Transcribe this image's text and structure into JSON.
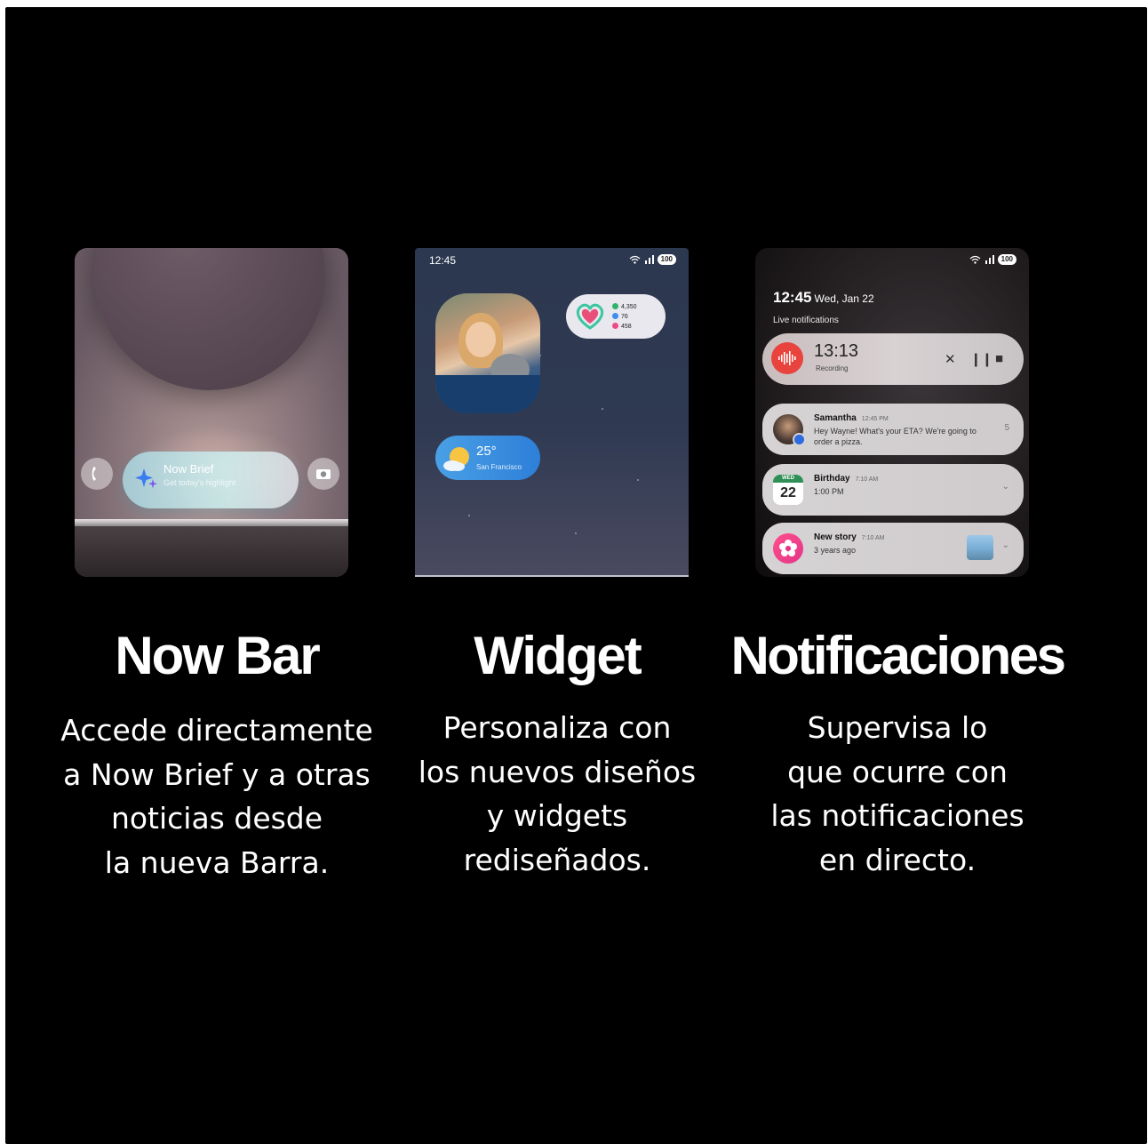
{
  "columns": [
    {
      "id": "now-bar",
      "title": "Now Bar",
      "lines": [
        "Accede directamente",
        "a Now Brief y a otras",
        "noticias desde",
        "la nueva Barra."
      ],
      "screen": {
        "nowbar_title": "Now Brief",
        "nowbar_subtitle": "Get today's highlight"
      }
    },
    {
      "id": "widget",
      "title": "Widget",
      "lines": [
        "Personaliza con",
        "los nuevos diseños",
        "y widgets",
        "rediseñados."
      ],
      "screen": {
        "status_time": "12:45",
        "battery": "100",
        "health_stats": [
          "4,350",
          "76",
          "458"
        ],
        "weather_temp": "25°",
        "weather_city": "San Francisco"
      }
    },
    {
      "id": "notificaciones",
      "title": "Notificaciones",
      "lines": [
        "Supervisa lo",
        "que ocurre con",
        "las notificaciones",
        "en directo."
      ],
      "screen": {
        "battery": "100",
        "clock_time": "12:45",
        "clock_date": "Wed, Jan 22",
        "section_label": "Live notifications",
        "recording_time": "13:13",
        "recording_label": "Recording",
        "notifications": [
          {
            "title": "Samantha",
            "time": "12:45 PM",
            "body": "Hey Wayne! What's your ETA? We're going to order a pizza.",
            "side": "5"
          },
          {
            "title": "Birthday",
            "time": "7:10 AM",
            "body": "1:00 PM",
            "cal_day": "WED",
            "cal_num": "22"
          },
          {
            "title": "New story",
            "time": "7:10 AM",
            "body": "3 years ago"
          }
        ]
      }
    }
  ],
  "colors": {
    "background": "#000000",
    "text": "#ffffff",
    "recording_red": "#e8433c"
  },
  "icons": [
    "phone-icon",
    "camera-icon",
    "sparkle-icon",
    "wifi-icon",
    "signal-icon",
    "heart-icon",
    "sun-cloud-icon",
    "waveform-icon",
    "close-icon",
    "pause-icon",
    "stop-icon",
    "flower-icon",
    "chevron-down-icon"
  ]
}
